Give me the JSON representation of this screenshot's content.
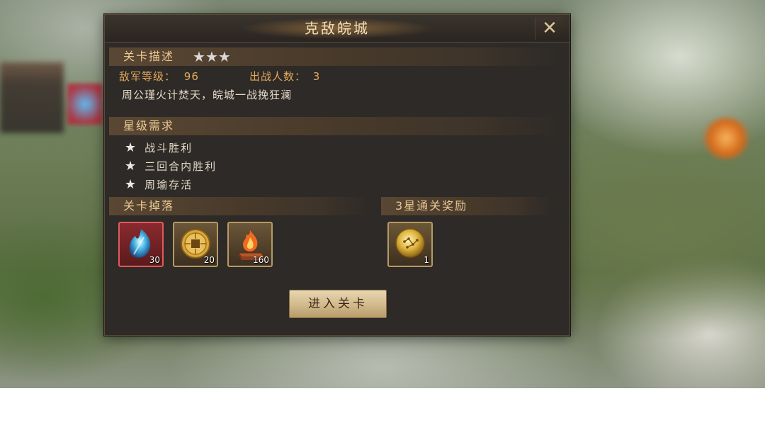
{
  "dialog": {
    "title": "克敌皖城",
    "close_icon": "close-icon"
  },
  "level_description": {
    "label": "关卡描述",
    "stars": 3,
    "enemy_level_label": "敌军等级：",
    "enemy_level_value": "96",
    "troop_count_label": "出战人数：",
    "troop_count_value": "3",
    "description": "周公瑾火计焚天，皖城一战挽狂澜"
  },
  "star_requirements": {
    "label": "星级需求",
    "items": [
      "战斗胜利",
      "三回合内胜利",
      "周瑜存活"
    ]
  },
  "drops": {
    "label": "关卡掉落",
    "items": [
      {
        "icon": "blue-crystal-icon",
        "count": "30"
      },
      {
        "icon": "gold-coin-icon",
        "count": "20"
      },
      {
        "icon": "fire-chest-icon",
        "count": "160"
      }
    ]
  },
  "three_star_reward": {
    "label": "3星通关奖励",
    "items": [
      {
        "icon": "gold-medallion-icon",
        "count": "1"
      }
    ]
  },
  "enter_button": {
    "label": "进入关卡"
  },
  "colors": {
    "panel": "#2d2a27",
    "section_text": "#e9c993",
    "accent_orange": "#e6a85a",
    "button": "#d3bc8f"
  }
}
